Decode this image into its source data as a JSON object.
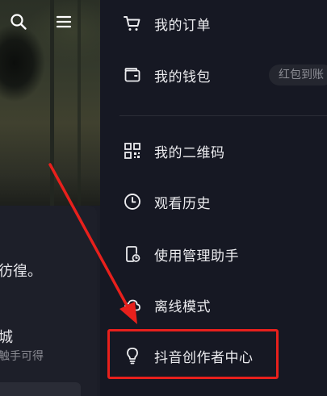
{
  "drawer": {
    "items": [
      {
        "label": "我的订单",
        "icon": "cart-icon"
      },
      {
        "label": "我的钱包",
        "icon": "wallet-icon",
        "badge": "红包到账"
      },
      {
        "label": "我的二维码",
        "icon": "qrcode-icon"
      },
      {
        "label": "观看历史",
        "icon": "clock-icon"
      },
      {
        "label": "使用管理助手",
        "icon": "phone-manager-icon"
      },
      {
        "label": "离线模式",
        "icon": "cloud-offline-icon"
      },
      {
        "label": "抖音创作者中心",
        "icon": "lightbulb-icon"
      }
    ]
  },
  "background": {
    "header_icons": [
      "search-icon",
      "menu-icon"
    ],
    "bio_fragment": "彷徨。",
    "location_fragment": "城",
    "hint_fragment": "触手可得"
  },
  "annotation": {
    "color": "#e8201c",
    "highlights": "抖音创作者中心"
  },
  "colors": {
    "drawer_bg": "#161823",
    "text_primary": "#ececef",
    "text_secondary": "#8c8d95",
    "badge_bg": "#24262f"
  }
}
